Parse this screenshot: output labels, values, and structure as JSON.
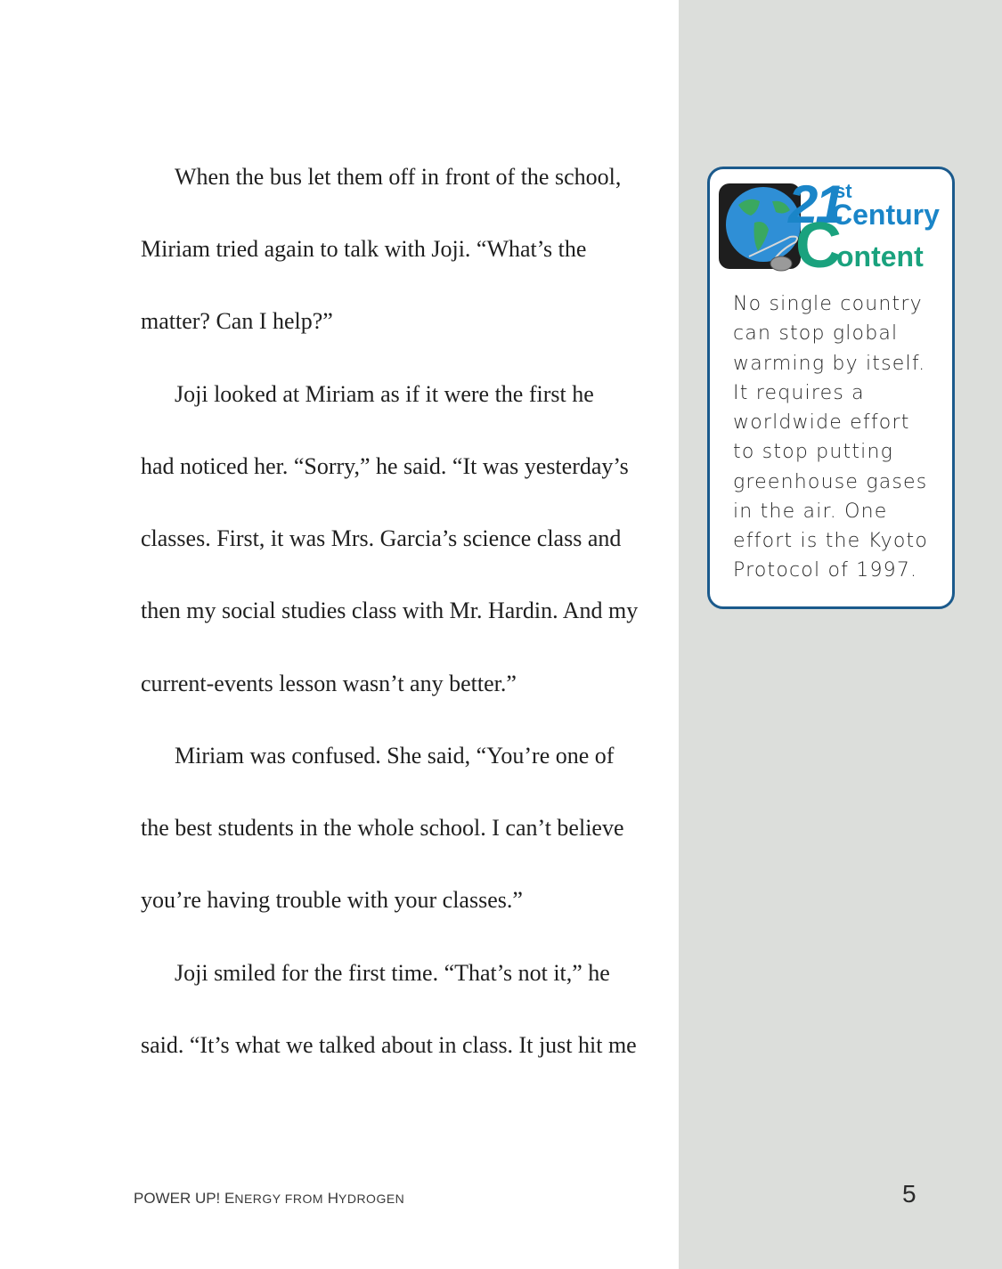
{
  "story": {
    "lines": [
      "When the bus let them off in front of the school,",
      "Miriam tried again to talk with Joji. “What’s the",
      "matter? Can I help?”",
      "Joji looked at Miriam as if it were the first he",
      "had noticed her. “Sorry,” he said. “It was yesterday’s",
      "classes. First, it was Mrs. Garcia’s science class and",
      "then my social studies class with Mr. Hardin. And my",
      "current-events lesson wasn’t any better.”",
      "Miriam was confused. She said, “You’re one of",
      "the best students in the whole school. I can’t believe",
      "you’re having trouble with your classes.”",
      "Joji smiled for the first time. “That’s not it,” he",
      "said. “It’s what we talked about in class. It just hit me"
    ]
  },
  "callout": {
    "logo": {
      "number": "21",
      "suffix": "st",
      "word1": "Century",
      "word2_initial": "C",
      "word2_rest": "ontent",
      "icon": "globe-mouse-icon",
      "colors": {
        "blue": "#1a85c8",
        "green": "#1aa27e",
        "border": "#1b5a8c"
      }
    },
    "lines": [
      "No single country",
      "can stop global",
      "warming by itself.",
      "It requires a",
      "worldwide effort",
      "to stop putting",
      "greenhouse gases",
      "in the air. One",
      "effort is the Kyoto",
      "Protocol of 1997."
    ]
  },
  "footer": {
    "title_main": "POWER UP! E",
    "title_sc1": "NERGY FROM",
    "title_h": " H",
    "title_sc2": "YDROGEN",
    "page_number": "5"
  }
}
